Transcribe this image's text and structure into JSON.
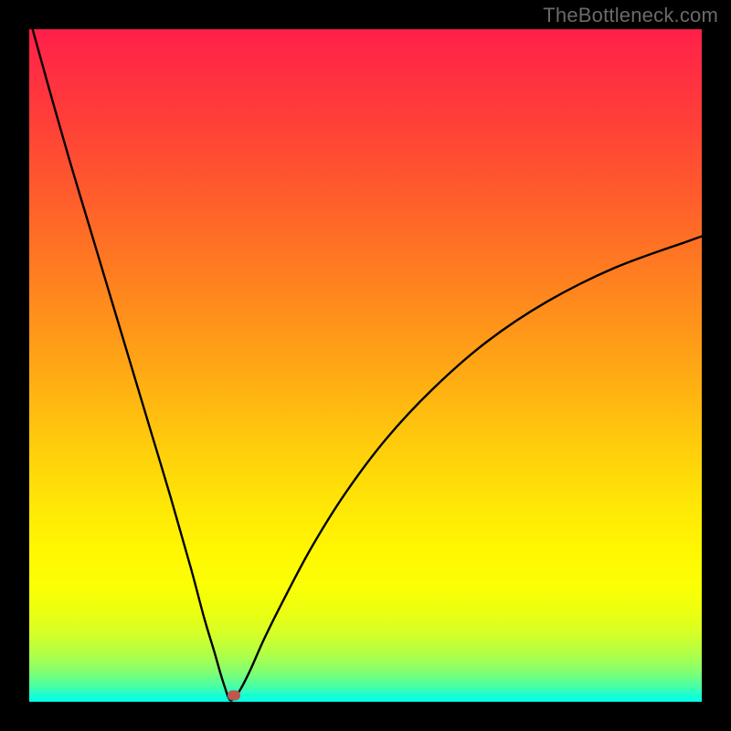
{
  "watermark": "TheBottleneck.com",
  "chart_data": {
    "type": "line",
    "title": "",
    "xlabel": "",
    "ylabel": "",
    "xlim": [
      0,
      100
    ],
    "ylim": [
      0,
      100
    ],
    "grid": false,
    "legend": false,
    "background_gradient": {
      "top": "#ff1e49",
      "mid": "#ffe400",
      "bottom": "#02fde9"
    },
    "series": [
      {
        "name": "bottleneck-curve",
        "color": "#000000",
        "x": [
          0.5,
          3,
          6,
          9,
          12,
          15,
          18,
          21,
          24,
          26,
          27.5,
          28.5,
          29.2,
          29.6,
          30.0,
          30.6,
          31.5,
          33,
          35,
          38,
          42,
          47,
          53,
          60,
          68,
          77,
          87,
          98,
          100
        ],
        "y": [
          100,
          91,
          80.5,
          70.5,
          60.5,
          50.5,
          40.5,
          30.5,
          20.0,
          12.5,
          7.5,
          4.0,
          1.8,
          0.7,
          0.2,
          0.7,
          2.0,
          5.0,
          9.5,
          15.5,
          23.0,
          31.0,
          39.0,
          46.5,
          53.5,
          59.5,
          64.5,
          68.5,
          69.2
        ]
      }
    ],
    "marker": {
      "name": "optimal-point",
      "x": 30.5,
      "y": 0.9,
      "color": "#bd584f"
    }
  }
}
